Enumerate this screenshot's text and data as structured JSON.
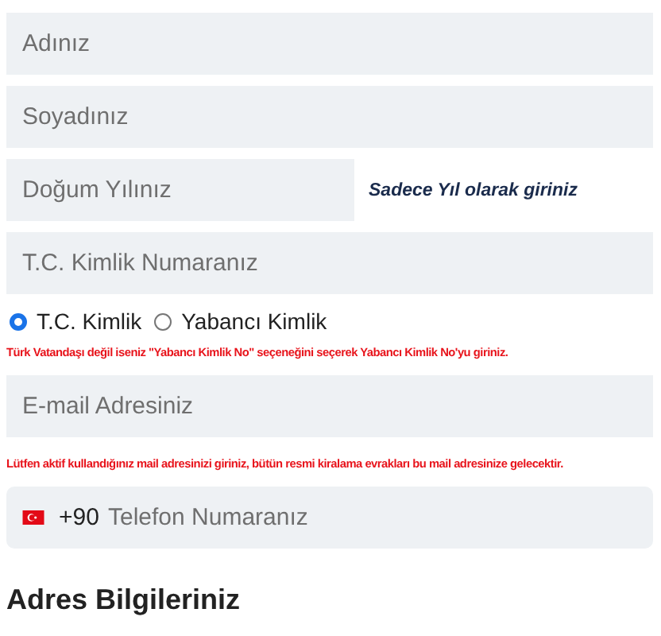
{
  "fields": [
    {
      "kind": "text",
      "placeholder": "Adınız",
      "narrow": false
    },
    {
      "kind": "text",
      "placeholder": "Soyadınız",
      "narrow": false
    },
    {
      "kind": "text",
      "placeholder": "Doğum Yılınız",
      "narrow": true,
      "hint": "Sadece Yıl olarak giriniz"
    },
    {
      "kind": "text",
      "placeholder": "T.C. Kimlik Numaranız",
      "narrow": false
    },
    {
      "kind": "radios",
      "options": [
        {
          "label": "T.C. Kimlik",
          "selected": true
        },
        {
          "label": "Yabancı Kimlik",
          "selected": false
        }
      ]
    },
    {
      "kind": "note",
      "text": "Türk Vatandaşı değil iseniz \"Yabancı Kimlik No\" seçeneğini seçerek Yabancı Kimlik No'yu giriniz."
    },
    {
      "kind": "text",
      "placeholder": "E-mail Adresiniz",
      "narrow": false
    },
    {
      "kind": "note",
      "text": "Lütfen aktif kullandığınız mail adresinizi giriniz, bütün resmi kiralama evrakları bu mail adresinize gelecektir."
    },
    {
      "kind": "phone",
      "code": "+90",
      "placeholder": "Telefon Numaranız"
    },
    {
      "kind": "heading",
      "text": "Adres Bilgileriniz"
    }
  ]
}
